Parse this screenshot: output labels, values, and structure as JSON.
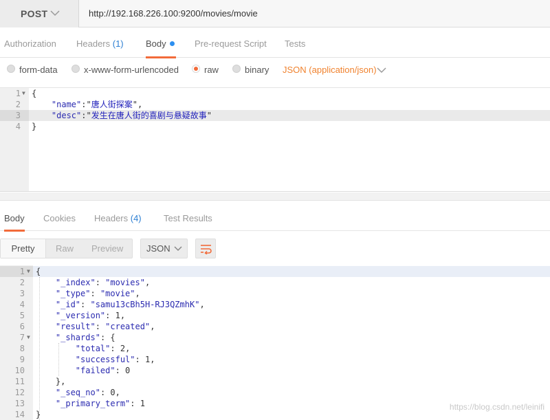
{
  "request": {
    "method": "POST",
    "url": "http://192.168.226.100:9200/movies/movie"
  },
  "request_tabs": [
    {
      "label": "Authorization"
    },
    {
      "label": "Headers ",
      "count": "(1)"
    },
    {
      "label": "Body",
      "active": true,
      "modified_dot": true
    },
    {
      "label": "Pre-request Script"
    },
    {
      "label": "Tests"
    }
  ],
  "body_types": {
    "options": [
      "form-data",
      "x-www-form-urlencoded",
      "raw",
      "binary"
    ],
    "selected": "raw",
    "content_type": "JSON (application/json)"
  },
  "request_body": {
    "line_numbers": [
      "1",
      "2",
      "3",
      "4"
    ],
    "open_brace": "{",
    "close_brace": "}",
    "name_key": "\"name\"",
    "name_value": "唐人街探案",
    "desc_key": "\"desc\"",
    "desc_value": "发生在唐人街的喜剧与悬疑故事"
  },
  "response_tabs": [
    {
      "label": "Body",
      "active": true
    },
    {
      "label": "Cookies"
    },
    {
      "label": "Headers ",
      "count": "(4)"
    },
    {
      "label": "Test Results"
    }
  ],
  "response_toolbar": {
    "view_modes": [
      "Pretty",
      "Raw",
      "Preview"
    ],
    "active_view": "Pretty",
    "format": "JSON"
  },
  "response_body": {
    "line_numbers": [
      "1",
      "2",
      "3",
      "4",
      "5",
      "6",
      "7",
      "8",
      "9",
      "10",
      "11",
      "12",
      "13",
      "14"
    ],
    "index_key": "\"_index\"",
    "index_value": "\"movies\"",
    "type_key": "\"_type\"",
    "type_value": "\"movie\"",
    "id_key": "\"_id\"",
    "id_value": "\"samu13cBh5H-RJ3QZmhK\"",
    "version_key": "\"_version\"",
    "version_value": "1",
    "result_key": "\"result\"",
    "result_value": "\"created\"",
    "shards_key": "\"_shards\"",
    "total_key": "\"total\"",
    "total_value": "2",
    "successful_key": "\"successful\"",
    "successful_value": "1",
    "failed_key": "\"failed\"",
    "failed_value": "0",
    "seq_no_key": "\"_seq_no\"",
    "seq_no_value": "0",
    "primary_term_key": "\"_primary_term\"",
    "primary_term_value": "1"
  },
  "watermark": "https://blog.csdn.net/leinifi",
  "colors": {
    "accent": "#f26b3a",
    "link_blue": "#2d7fd3",
    "content_type": "#f0822e",
    "code_string": "#2b2bb0"
  },
  "icons": [
    "chevron-down-icon",
    "word-wrap-icon",
    "fold-arrow-icon"
  ]
}
